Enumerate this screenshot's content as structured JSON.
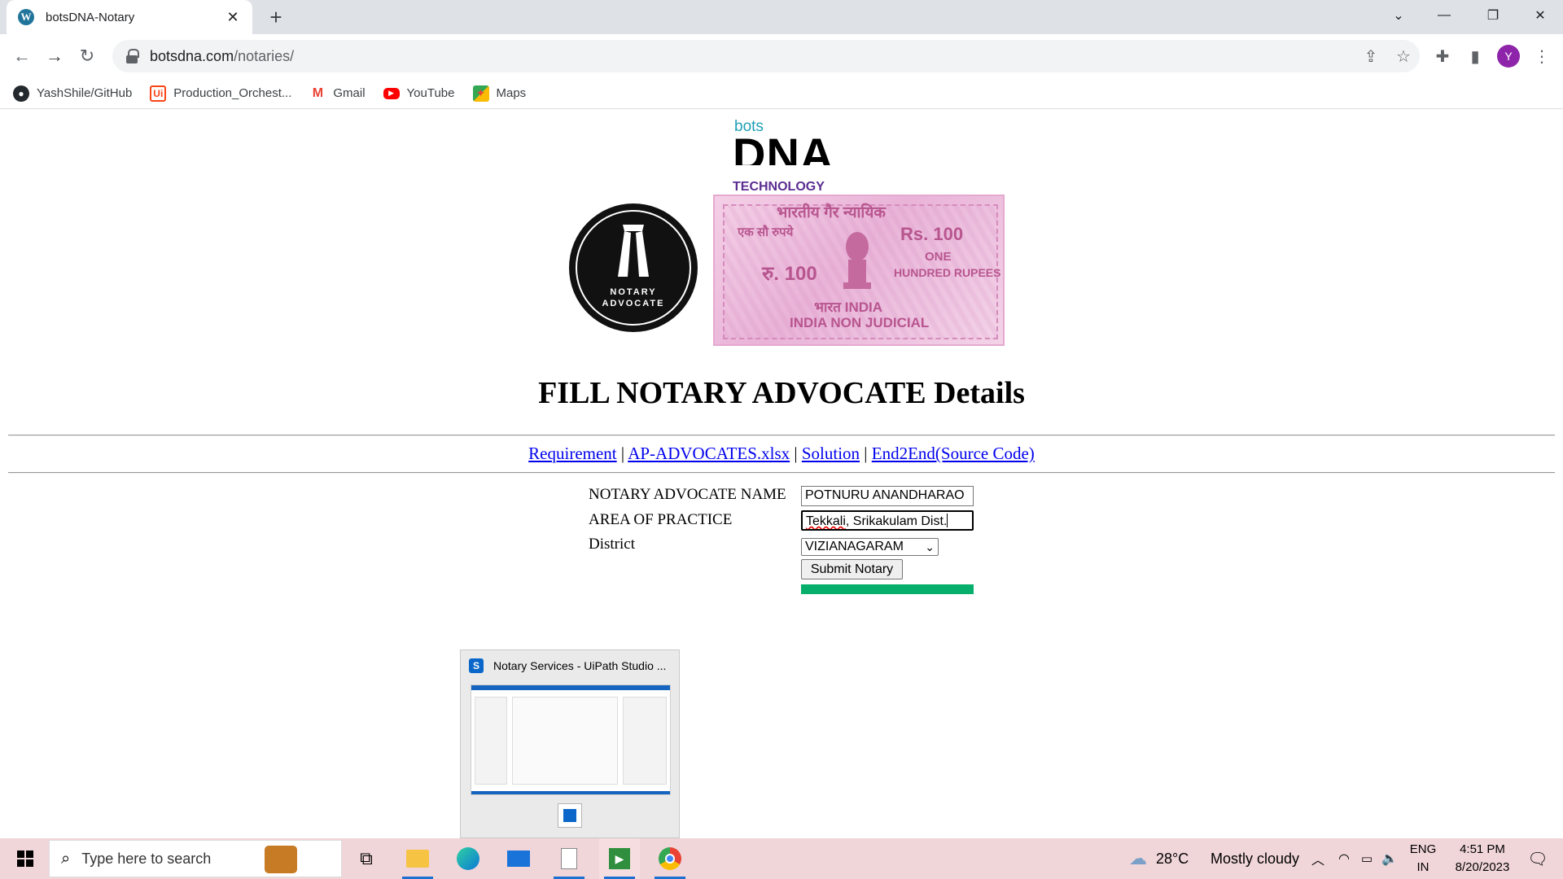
{
  "browser": {
    "tab_title": "botsDNA-Notary",
    "url_host": "botsdna.com",
    "url_path": "/notaries/",
    "profile_initial": "Y",
    "bookmarks": [
      {
        "label": "YashShile/GitHub",
        "icon": "github-icon"
      },
      {
        "label": "Production_Orchest...",
        "icon": "uipath-icon"
      },
      {
        "label": "Gmail",
        "icon": "gmail-icon"
      },
      {
        "label": "YouTube",
        "icon": "youtube-icon"
      },
      {
        "label": "Maps",
        "icon": "maps-icon"
      }
    ]
  },
  "logo": {
    "bots": "bots",
    "dna": "DNA",
    "technology": "TECHNOLOGY"
  },
  "notary_badge": {
    "line1": "NOTARY",
    "line2": "ADVOCATE"
  },
  "stamp": {
    "hindi_top": "भारतीय गैर न्यायिक",
    "hindi_value": "एक सौ रुपये",
    "rs_value": "Rs. 100",
    "rupee_hindi": "रु. 100",
    "one": "ONE",
    "hundred": "HUNDRED RUPEES",
    "bharat": "भारत INDIA",
    "non_judicial": "INDIA NON JUDICIAL"
  },
  "page": {
    "title": "FILL NOTARY ADVOCATE Details",
    "links": [
      "Requirement",
      "AP-ADVOCATES.xlsx",
      "Solution",
      "End2End(Source Code)"
    ],
    "separator": "|"
  },
  "form": {
    "name_label": "NOTARY ADVOCATE NAME",
    "name_value": "POTNURU ANANDHARAO",
    "area_label": "AREA OF PRACTICE",
    "area_value_spell": "Tekkali",
    "area_value_rest": ", Srikakulam Dist.",
    "district_label": "District",
    "district_value": "VIZIANAGARAM",
    "submit_label": "Submit Notary",
    "progress_fraction": 1.0,
    "progress_color": "#06b06c"
  },
  "thumbnail": {
    "title": "Notary Services - UiPath Studio ..."
  },
  "taskbar": {
    "search_placeholder": "Type here to search",
    "weather_temp": "28°C",
    "weather_desc": "Mostly cloudy",
    "lang_line1": "ENG",
    "lang_line2": "IN",
    "time": "4:51 PM",
    "date": "8/20/2023"
  }
}
